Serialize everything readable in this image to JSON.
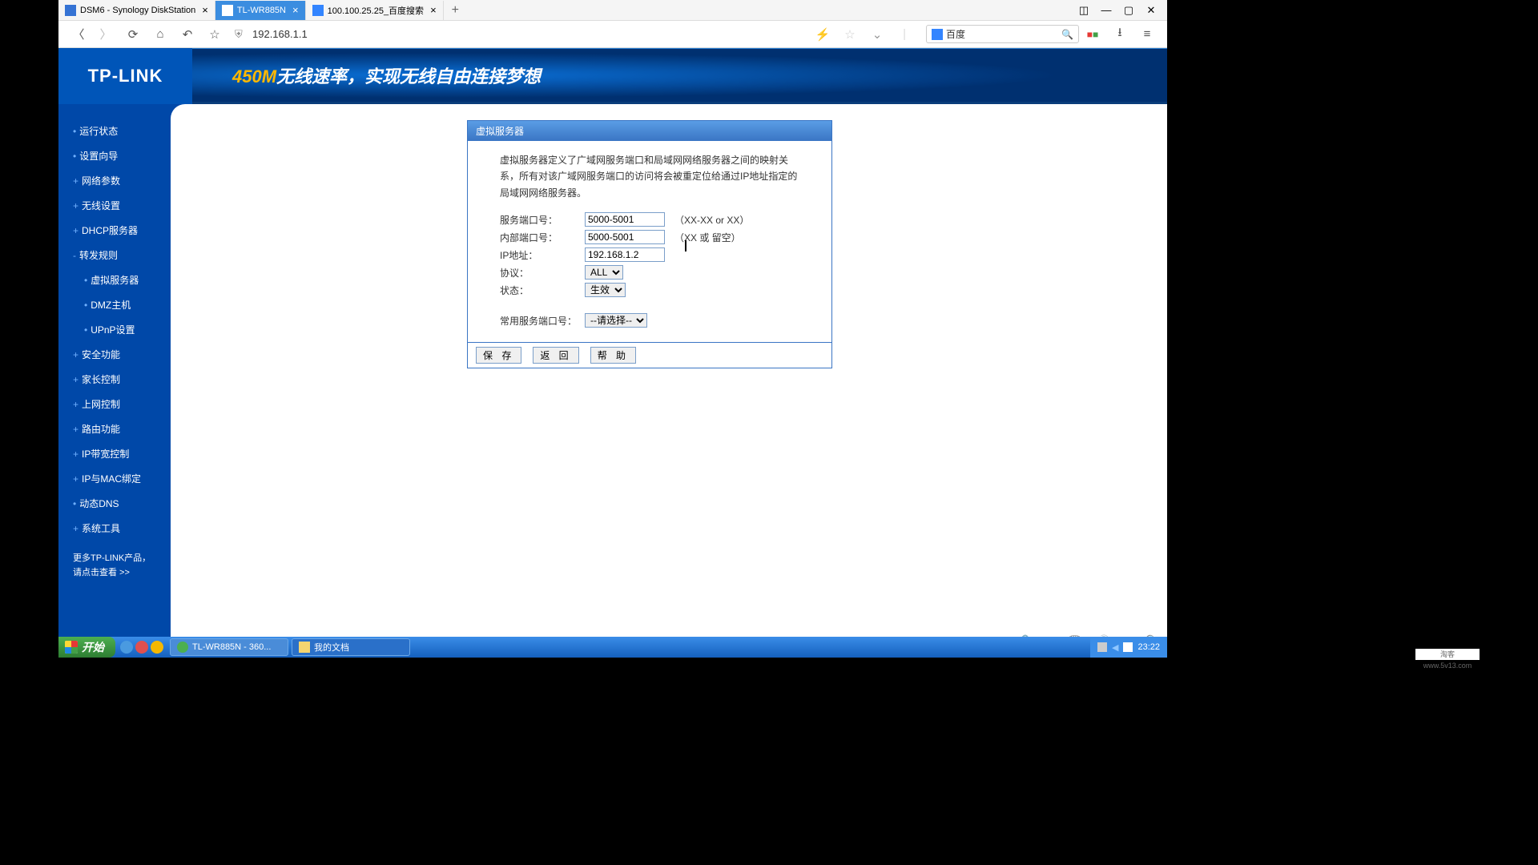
{
  "tabs": [
    {
      "label": "DSM6 - Synology DiskStation",
      "active": false
    },
    {
      "label": "TL-WR885N",
      "active": true
    },
    {
      "label": "100.100.25.25_百度搜索",
      "active": false
    }
  ],
  "url": "192.168.1.1",
  "search_engine": "百度",
  "logo": "TP-LINK",
  "banner": {
    "prefix": "450M",
    "text": "无线速率，实现无线自由连接梦想"
  },
  "sidebar": {
    "items": [
      {
        "bullet": "•",
        "label": "运行状态"
      },
      {
        "bullet": "•",
        "label": "设置向导"
      },
      {
        "bullet": "+",
        "label": "网络参数"
      },
      {
        "bullet": "+",
        "label": "无线设置"
      },
      {
        "bullet": "+",
        "label": "DHCP服务器"
      },
      {
        "bullet": "-",
        "label": "转发规则"
      },
      {
        "bullet": "•",
        "label": "虚拟服务器",
        "sub": true
      },
      {
        "bullet": "•",
        "label": "DMZ主机",
        "sub": true
      },
      {
        "bullet": "•",
        "label": "UPnP设置",
        "sub": true
      },
      {
        "bullet": "+",
        "label": "安全功能"
      },
      {
        "bullet": "+",
        "label": "家长控制"
      },
      {
        "bullet": "+",
        "label": "上网控制"
      },
      {
        "bullet": "+",
        "label": "路由功能"
      },
      {
        "bullet": "+",
        "label": "IP带宽控制"
      },
      {
        "bullet": "+",
        "label": "IP与MAC绑定"
      },
      {
        "bullet": "•",
        "label": "动态DNS"
      },
      {
        "bullet": "+",
        "label": "系统工具"
      }
    ],
    "more_line1": "更多TP-LINK产品，",
    "more_line2": "请点击查看 >>"
  },
  "form": {
    "title": "虚拟服务器",
    "desc": "虚拟服务器定义了广域网服务端口和局域网网络服务器之间的映射关系，所有对该广域网服务端口的访问将会被重定位给通过IP地址指定的局域网网络服务器。",
    "service_port_label": "服务端口号：",
    "service_port_value": "5000-5001",
    "service_port_hint": "（XX-XX or XX）",
    "internal_port_label": "内部端口号：",
    "internal_port_value": "5000-5001",
    "internal_port_hint": "（XX 或 留空）",
    "ip_label": "IP地址：",
    "ip_value": "192.168.1.2",
    "protocol_label": "协议：",
    "protocol_value": "ALL",
    "status_label": "状态：",
    "status_value": "生效",
    "common_port_label": "常用服务端口号：",
    "common_port_value": "--请选择--",
    "btn_save": "保 存",
    "btn_back": "返 回",
    "btn_help": "帮 助"
  },
  "taskbar": {
    "start": "开始",
    "items": [
      {
        "label": "TL-WR885N - 360...",
        "active": true
      },
      {
        "label": "我的文档",
        "active": false
      }
    ],
    "time": "23:22"
  },
  "watermark": "淘客 www.5v13.com"
}
